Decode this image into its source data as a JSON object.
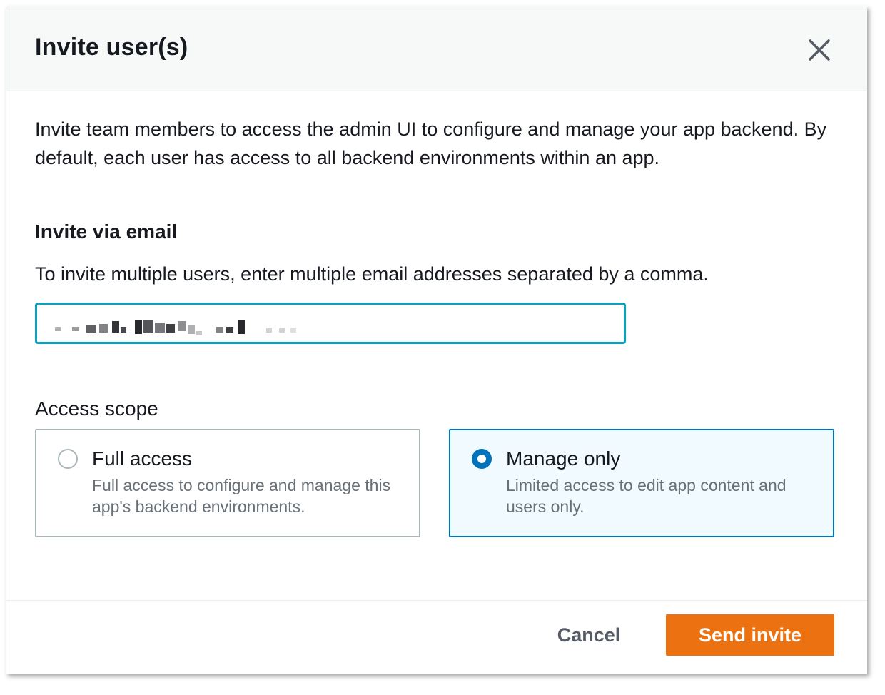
{
  "dialog": {
    "title": "Invite user(s)",
    "description": "Invite team members to access the admin UI to configure and manage your app backend. By default, each user has access to all backend environments within an app."
  },
  "invite_via_email": {
    "heading": "Invite via email",
    "hint": "To invite multiple users, enter multiple email addresses separated by a comma.",
    "email_value": ""
  },
  "access_scope": {
    "label": "Access scope",
    "options": [
      {
        "title": "Full access",
        "description": "Full access to configure and manage this app's backend environments.",
        "selected": false
      },
      {
        "title": "Manage only",
        "description": "Limited access to edit app content and users only.",
        "selected": true
      }
    ]
  },
  "footer": {
    "cancel_label": "Cancel",
    "send_label": "Send invite"
  },
  "icons": {
    "close": "close-icon"
  },
  "colors": {
    "accent": "#0073bb",
    "primary_button": "#ec7211",
    "input_focus": "#0aa0c0",
    "text": "#16191f",
    "secondary_text": "#687078"
  }
}
